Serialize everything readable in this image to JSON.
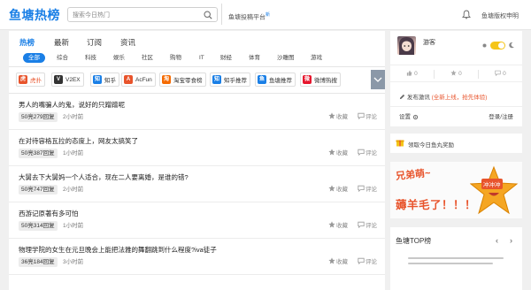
{
  "header": {
    "logo": "鱼塘热榜",
    "search_placeholder": "搜索今日热门",
    "platform": "鱼塘投稿平台",
    "platform_badge": "新",
    "copyright": "鱼塘版权申明"
  },
  "main": {
    "tabs": [
      {
        "label": "热榜",
        "active": true
      },
      {
        "label": "最新"
      },
      {
        "label": "订阅"
      },
      {
        "label": "资讯"
      }
    ],
    "subtabs": [
      {
        "label": "全部",
        "active": true
      },
      {
        "label": "综合"
      },
      {
        "label": "科技"
      },
      {
        "label": "娱乐"
      },
      {
        "label": "社区"
      },
      {
        "label": "购物"
      },
      {
        "label": "IT"
      },
      {
        "label": "财经"
      },
      {
        "label": "体育"
      },
      {
        "label": "沙雕图"
      },
      {
        "label": "游戏"
      }
    ],
    "sources": [
      {
        "label": "虎扑",
        "icon": "hupu-icon",
        "color": "#e8542c",
        "active": true
      },
      {
        "label": "V2EX",
        "icon": "v2ex-icon",
        "color": "#333333"
      },
      {
        "label": "知乎",
        "icon": "zhihu-icon",
        "color": "#1a7fe6"
      },
      {
        "label": "AcFun",
        "icon": "acfun-icon",
        "color": "#e8542c"
      },
      {
        "label": "淘宝零食榜",
        "icon": "taobao-icon",
        "color": "#f56a00"
      },
      {
        "label": "知乎推荐",
        "icon": "zhihu-icon",
        "color": "#1a7fe6"
      },
      {
        "label": "鱼塘推荐",
        "icon": "fish-icon",
        "color": "#1a7fe6"
      },
      {
        "label": "微博热搜",
        "icon": "weibo-icon",
        "color": "#e6162d"
      }
    ],
    "items": [
      {
        "title": "男人的嘴骗人的鬼，说好的只蹭蹭呢",
        "count": "50亮279回复",
        "time": "2小时前",
        "fav": "收藏",
        "comment": "评论"
      },
      {
        "title": "在对待容格瓦拉的态度上，网友太搞笑了",
        "count": "50亮387回复",
        "time": "1小时前",
        "fav": "收藏",
        "comment": "评论"
      },
      {
        "title": "大舅去下大舅妈一个人适合，现在二人要离婚，是谁的错?",
        "count": "50亮747回复",
        "time": "2小时前",
        "fav": "收藏",
        "comment": "评论"
      },
      {
        "title": "西游记原著有多可怕",
        "count": "50亮314回复",
        "time": "1小时前",
        "fav": "收藏",
        "comment": "评论"
      },
      {
        "title": "物理学院的女生在元旦晚会上能把法雅的舞翻跳到什么程度?iva徒子",
        "count": "36亮184回复",
        "time": "3小时前",
        "fav": "收藏",
        "comment": "评论"
      }
    ]
  },
  "user": {
    "name": "游客",
    "stats": [
      "0",
      "0",
      "0"
    ],
    "publish_label": "发布激讯",
    "publish_hint": "(全新上线，抢先体验)",
    "settings": "设置",
    "login": "登录/注册"
  },
  "reward": {
    "label": "领取今日鱼丸奖励"
  },
  "banner": {
    "top": "兄弟萌~",
    "bottom": "薅羊毛了！！！",
    "tag": "冲冲冲"
  },
  "top_list": {
    "title": "鱼塘TOP榜"
  }
}
